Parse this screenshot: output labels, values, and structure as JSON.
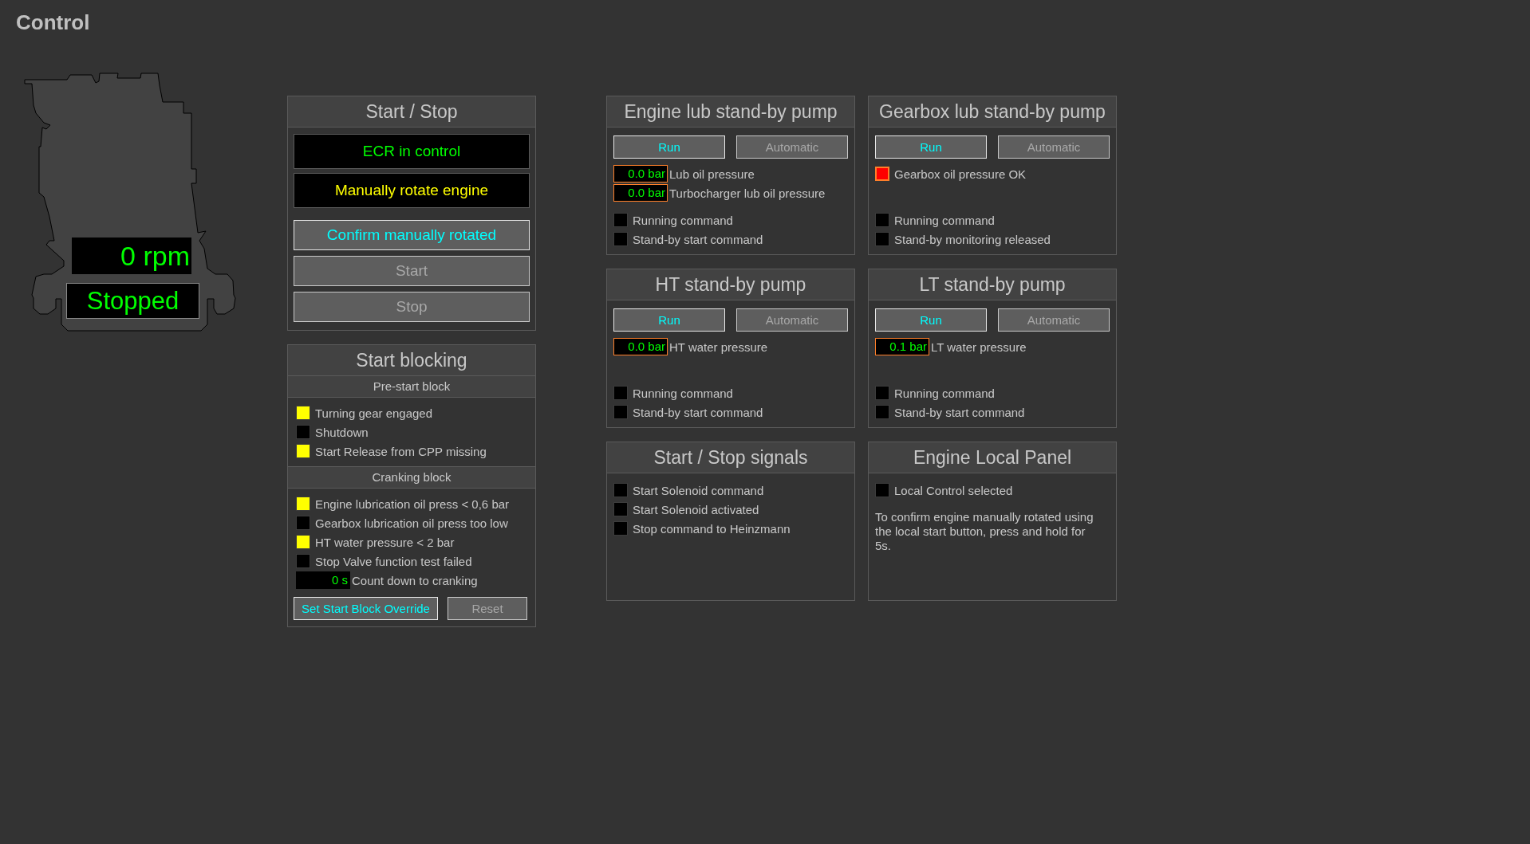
{
  "page_title": "Control",
  "engine": {
    "speed": "0 rpm",
    "state": "Stopped"
  },
  "start_stop": {
    "title": "Start / Stop",
    "status": [
      {
        "text": "ECR in control",
        "kind": "normal"
      },
      {
        "text": "Manually rotate engine",
        "kind": "warning"
      }
    ],
    "buttons": [
      {
        "label": "Confirm manually rotated",
        "disabled": false
      },
      {
        "label": "Start",
        "disabled": true
      },
      {
        "label": "Stop",
        "disabled": true
      }
    ]
  },
  "start_blocking": {
    "title": "Start blocking",
    "sections": [
      {
        "title": "Pre-start block",
        "items": [
          {
            "kind": "lamp",
            "label": "Turning gear engaged",
            "color": "#ffff00",
            "alarm": false
          },
          {
            "kind": "lamp",
            "label": "Shutdown",
            "color": "#000000",
            "alarm": false
          },
          {
            "kind": "lamp",
            "label": "Start Release from CPP missing",
            "color": "#ffff00",
            "alarm": false
          }
        ]
      },
      {
        "title": "Cranking block",
        "items": [
          {
            "kind": "lamp",
            "label": "Engine lubrication oil press < 0,6 bar",
            "color": "#ffff00",
            "alarm": false
          },
          {
            "kind": "lamp",
            "label": "Gearbox lubrication oil press too low",
            "color": "#000000",
            "alarm": false
          },
          {
            "kind": "lamp",
            "label": "HT water pressure < 2 bar",
            "color": "#ffff00",
            "alarm": false
          },
          {
            "kind": "lamp",
            "label": "Stop Valve function test failed",
            "color": "#000000",
            "alarm": false
          },
          {
            "kind": "readout",
            "reading": "0 s",
            "label": "Count down to cranking",
            "alarm": false
          }
        ]
      }
    ],
    "buttons": [
      {
        "label": "Set Start Block Override",
        "disabled": false
      },
      {
        "label": "Reset",
        "disabled": true
      }
    ]
  },
  "panels": [
    {
      "title": "Engine lub stand-by pump",
      "buttons": [
        {
          "label": "Run",
          "disabled": false
        },
        {
          "label": "Automatic",
          "disabled": true
        }
      ],
      "top": [
        {
          "kind": "readout",
          "reading": "0.0 bar",
          "label": "Lub oil pressure",
          "alarm": true
        },
        {
          "kind": "readout",
          "reading": "0.0 bar",
          "label": "Turbocharger lub oil pressure",
          "alarm": true
        }
      ],
      "bottom": [
        {
          "kind": "lamp",
          "label": "Running command",
          "color": "#000000",
          "alarm": false
        },
        {
          "kind": "lamp",
          "label": "Stand-by start command",
          "color": "#000000",
          "alarm": false
        }
      ]
    },
    {
      "title": "Gearbox lub stand-by pump",
      "buttons": [
        {
          "label": "Run",
          "disabled": false
        },
        {
          "label": "Automatic",
          "disabled": true
        }
      ],
      "top": [
        {
          "kind": "lamp",
          "label": "Gearbox oil pressure OK",
          "color": "#ff0000",
          "alarm": true
        }
      ],
      "bottom": [
        {
          "kind": "lamp",
          "label": "Running command",
          "color": "#000000",
          "alarm": false
        },
        {
          "kind": "lamp",
          "label": "Stand-by monitoring released",
          "color": "#000000",
          "alarm": false
        }
      ]
    },
    {
      "title": "HT stand-by pump",
      "buttons": [
        {
          "label": "Run",
          "disabled": false
        },
        {
          "label": "Automatic",
          "disabled": true
        }
      ],
      "top": [
        {
          "kind": "readout",
          "reading": "0.0 bar",
          "label": "HT water pressure",
          "alarm": true
        }
      ],
      "bottom": [
        {
          "kind": "lamp",
          "label": "Running command",
          "color": "#000000",
          "alarm": false
        },
        {
          "kind": "lamp",
          "label": "Stand-by start command",
          "color": "#000000",
          "alarm": false
        }
      ]
    },
    {
      "title": "LT stand-by pump",
      "buttons": [
        {
          "label": "Run",
          "disabled": false
        },
        {
          "label": "Automatic",
          "disabled": true
        }
      ],
      "top": [
        {
          "kind": "readout",
          "reading": "0.1 bar",
          "label": "LT water pressure",
          "alarm": true
        }
      ],
      "bottom": [
        {
          "kind": "lamp",
          "label": "Running command",
          "color": "#000000",
          "alarm": false
        },
        {
          "kind": "lamp",
          "label": "Stand-by start command",
          "color": "#000000",
          "alarm": false
        }
      ]
    },
    {
      "title": "Start / Stop signals",
      "top": [
        {
          "kind": "lamp",
          "label": "Start Solenoid command",
          "color": "#000000",
          "alarm": false
        },
        {
          "kind": "lamp",
          "label": "Start Solenoid activated",
          "color": "#000000",
          "alarm": false
        },
        {
          "kind": "lamp",
          "label": "Stop command to Heinzmann",
          "color": "#000000",
          "alarm": false
        }
      ]
    },
    {
      "title": "Engine Local Panel",
      "top": [
        {
          "kind": "lamp",
          "label": "Local Control selected",
          "color": "#000000",
          "alarm": false
        }
      ],
      "note": "To confirm engine manually rotated using the local start button, press and hold for 5s."
    }
  ]
}
